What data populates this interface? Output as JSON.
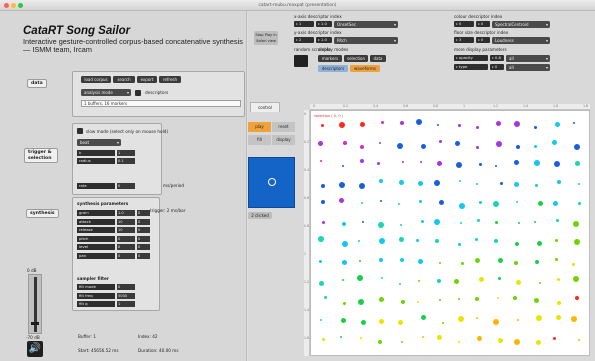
{
  "window": {
    "title": "catart-mubu.maxpat (presentation)"
  },
  "app": {
    "title": "CataRT Song Sailor",
    "subtitle": "Interactive gesture-controlled corpus-based concatenative synthesis — ISMM team, Ircam"
  },
  "sections": {
    "data": "data",
    "trigger": "trigger & selection",
    "synthesis": "synthesis"
  },
  "data_panel": {
    "buttons": [
      "load corpus",
      "search",
      "export",
      "refresh"
    ],
    "analysis_dropdown": "analysis mode",
    "analysis_value": "0",
    "analysis_label": "descriptors",
    "file_field": "1 buffers, 16 markers"
  },
  "trigger_panel": {
    "checkbox_label": "slow mode (select only on mouse hold)",
    "trigger_mode": "beat",
    "rows": [
      {
        "name": "k",
        "value": "1"
      },
      {
        "name": "radius",
        "value": "0.1"
      }
    ],
    "rate_name": "rate",
    "rate_value": "0",
    "rate_label": "ms/period"
  },
  "synth_panel": {
    "heading": "synthesis parameters",
    "trigger_label": "trigger: 2 ms/bar",
    "params": [
      {
        "name": "grain",
        "v1": "1.0",
        "v2": "0"
      },
      {
        "name": "attack",
        "v1": "10",
        "v2": "0"
      },
      {
        "name": "release",
        "v1": "10",
        "v2": "0"
      },
      {
        "name": "pitch",
        "v1": "0",
        "v2": "0"
      },
      {
        "name": "level",
        "v1": "0",
        "v2": "0"
      },
      {
        "name": "pan",
        "v1": "0",
        "v2": "0"
      }
    ],
    "filter_heading": "sampler filter",
    "filters": [
      {
        "name": "filt mode",
        "value": "0"
      },
      {
        "name": "filt freq",
        "value": "5000"
      },
      {
        "name": "filt q",
        "value": "1"
      }
    ]
  },
  "meter": {
    "label_top": "0 dB",
    "label_bottom": "-70 dB"
  },
  "status": {
    "buffer": "Buffer: 1",
    "index": "Index: 42",
    "start": "Start: 45656.52 ms",
    "duration": "Duration: 40.00 ms"
  },
  "right_top": {
    "play_button": "Stop Play in Safari view",
    "x_label": "x-axis descriptor index",
    "x_num": "1",
    "x_field": "1.0",
    "x_dd": "OnsetSec",
    "y_label": "y-axis descriptor index",
    "y_num": "2",
    "y_field": "1.0",
    "y_dd": "Pitch",
    "random_label": "random scramble",
    "display_label": "display modes",
    "display_buttons": [
      "markers",
      "selection",
      "data"
    ],
    "display_buttons2": [
      "descriptors",
      "waveforms"
    ],
    "color_label": "colour descriptor index",
    "color_num": "0",
    "color_field": "0",
    "color_dd": "SpectralCentroid",
    "size_label": "floor size descriptor index",
    "size_num": "3",
    "size_field": "0",
    "size_dd": "Loudness",
    "extra_label": "more display parameters",
    "extra_rows": [
      {
        "name": "opacity",
        "value": "0.8",
        "dd": "all"
      },
      {
        "name": "type",
        "value": "0",
        "dd": "all"
      }
    ]
  },
  "view_panel": {
    "control_tab": "control",
    "btn_play": "play",
    "btn_reset": "reset",
    "btn_view": "fill",
    "btn_zoom": "display",
    "btn_clear": "2 clicked"
  },
  "ruler_ticks": [
    "0",
    "0.2",
    "0.4",
    "0.6",
    "0.8",
    "1",
    "1.2",
    "1.4",
    "1.6",
    "1.8"
  ],
  "colors": {
    "accent_orange": "#f0a23a",
    "accent_blue": "#1464c8",
    "dot_palette": [
      "#ff2a1a",
      "#ffb400",
      "#e6e600",
      "#6fd400",
      "#18d048",
      "#16d8b0",
      "#10c8f0",
      "#1a5ee0",
      "#a636e0",
      "#d42ad0"
    ]
  },
  "canvas_caption": "selection ( 0, 0 )"
}
